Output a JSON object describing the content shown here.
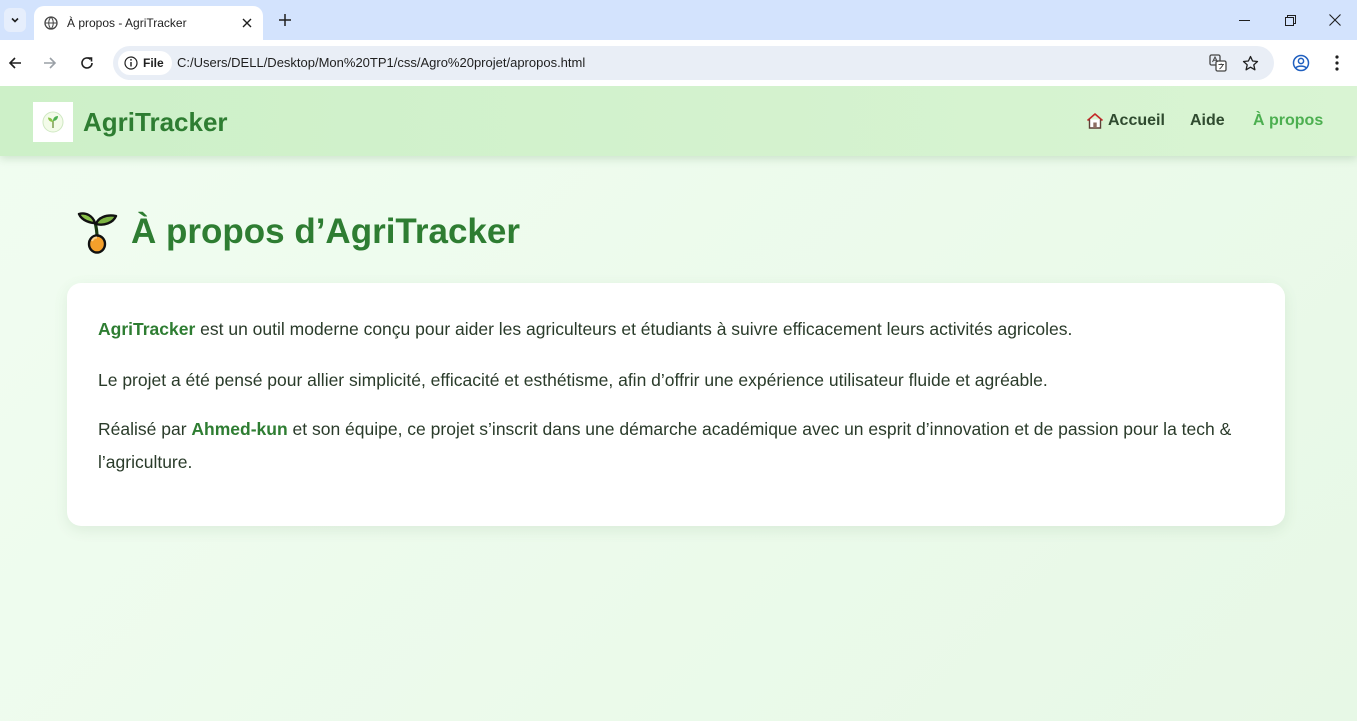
{
  "browser": {
    "tab_title": "À propos - AgriTracker",
    "site_chip": "File",
    "url": "C:/Users/DELL/Desktop/Mon%20TP1/css/Agro%20projet/apropos.html"
  },
  "header": {
    "brand": "AgriTracker",
    "nav": [
      {
        "label": "Accueil",
        "icon": "house-icon"
      },
      {
        "label": "Aide"
      },
      {
        "label": "À propos",
        "active": true
      }
    ]
  },
  "main": {
    "title": "À propos d’AgriTracker",
    "p1": {
      "strong": "AgriTracker",
      "rest": " est un outil moderne conçu pour aider les agriculteurs et étudiants à suivre efficacement leurs activités agricoles."
    },
    "p2": "Le projet a été pensé pour allier simplicité, efficacité et esthétisme, afin d’offrir une expérience utilisateur fluide et agréable.",
    "p3": {
      "before": "Réalisé par ",
      "strong": "Ahmed-kun",
      "after": " et son équipe, ce projet s’inscrit dans une démarche académique avec un esprit d’innovation et de passion pour la tech & l’agriculture."
    }
  },
  "colors": {
    "brand": "#2e7d32",
    "nav_active": "#4caf50",
    "header_bg": "#d3f1cd",
    "page_bg": "#eaf8ea"
  }
}
